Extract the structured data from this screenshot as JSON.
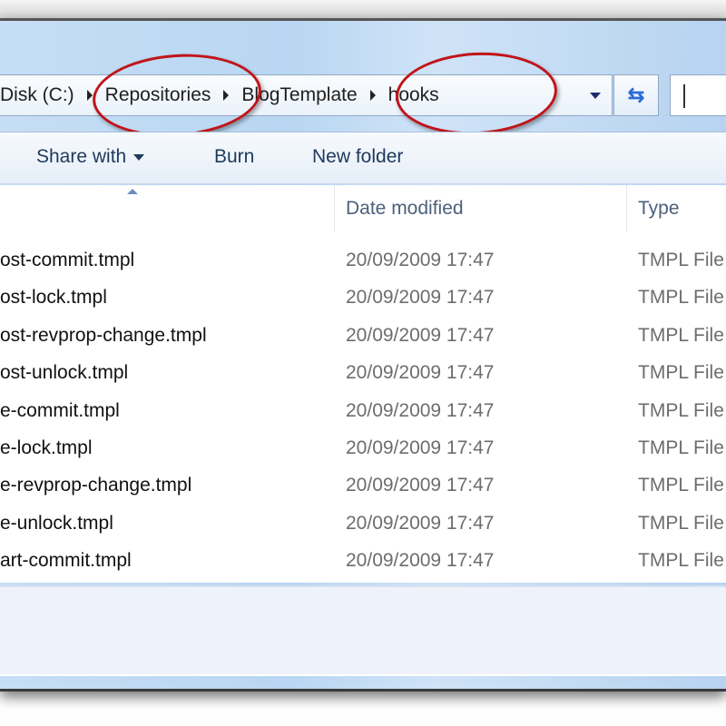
{
  "address": {
    "crumbs": [
      "Disk (C:)",
      "Repositories",
      "BlogTemplate",
      "hooks"
    ]
  },
  "toolbar": {
    "share_with": "Share with",
    "burn": "Burn",
    "new_folder": "New folder"
  },
  "columns": {
    "date": "Date modified",
    "type": "Type"
  },
  "files": [
    {
      "name": "ost-commit.tmpl",
      "date": "20/09/2009 17:47",
      "type": "TMPL File"
    },
    {
      "name": "ost-lock.tmpl",
      "date": "20/09/2009 17:47",
      "type": "TMPL File"
    },
    {
      "name": "ost-revprop-change.tmpl",
      "date": "20/09/2009 17:47",
      "type": "TMPL File"
    },
    {
      "name": "ost-unlock.tmpl",
      "date": "20/09/2009 17:47",
      "type": "TMPL File"
    },
    {
      "name": "e-commit.tmpl",
      "date": "20/09/2009 17:47",
      "type": "TMPL File"
    },
    {
      "name": "e-lock.tmpl",
      "date": "20/09/2009 17:47",
      "type": "TMPL File"
    },
    {
      "name": "e-revprop-change.tmpl",
      "date": "20/09/2009 17:47",
      "type": "TMPL File"
    },
    {
      "name": "e-unlock.tmpl",
      "date": "20/09/2009 17:47",
      "type": "TMPL File"
    },
    {
      "name": "art-commit.tmpl",
      "date": "20/09/2009 17:47",
      "type": "TMPL File"
    }
  ],
  "colors": {
    "annotation": "#c0141a"
  }
}
